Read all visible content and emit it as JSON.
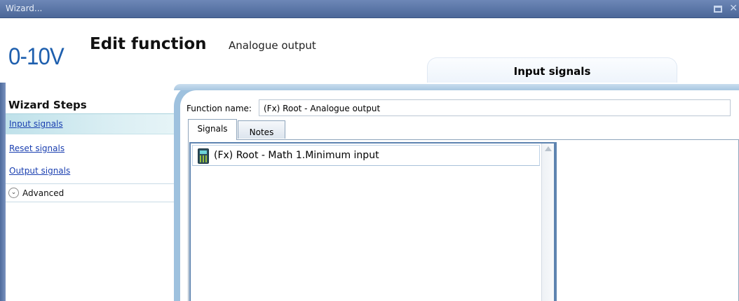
{
  "window": {
    "title": "Wizard...",
    "icons": {
      "maximize": "maximize-icon",
      "close": "close-icon"
    }
  },
  "header": {
    "logo_text": "0-10V",
    "title": "Edit function",
    "subtitle": "Analogue output",
    "current_step_tab": "Input signals"
  },
  "sidebar": {
    "title": "Wizard Steps",
    "items": [
      {
        "label": "Input signals",
        "active": true
      },
      {
        "label": "Reset signals",
        "active": false
      },
      {
        "label": "Output signals",
        "active": false
      }
    ],
    "advanced_label": "Advanced",
    "advanced_icon": "chevron-down-circle-icon"
  },
  "main": {
    "function_name_label": "Function name:",
    "function_name_value": "(Fx) Root - Analogue output",
    "tabs": [
      {
        "label": "Signals",
        "active": true
      },
      {
        "label": "Notes",
        "active": false
      }
    ],
    "signals": [
      {
        "icon": "calculator-icon",
        "label": "(Fx) Root - Math 1.Minimum input"
      }
    ]
  },
  "colors": {
    "titlebar": "#4b6798",
    "logo": "#1e5fae",
    "link": "#1a3fb0",
    "frame": "#9ec1de",
    "active_item": "#bfe1ea"
  }
}
